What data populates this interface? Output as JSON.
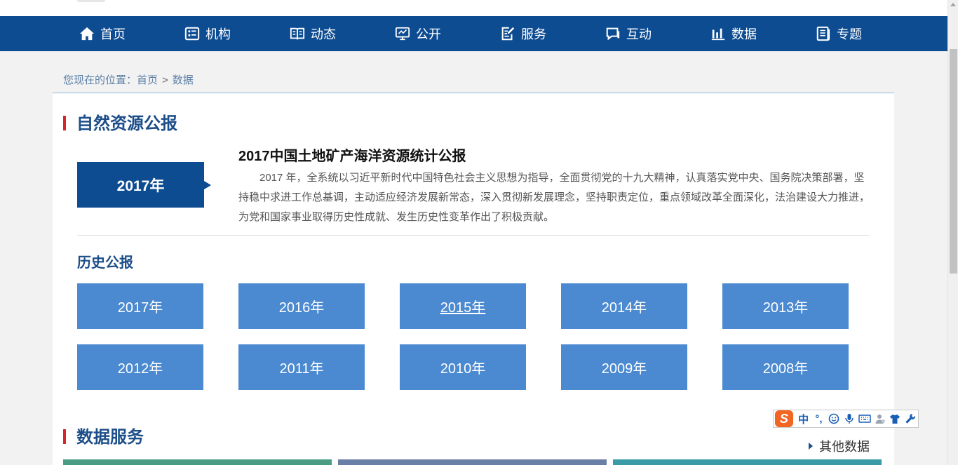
{
  "nav": {
    "items": [
      {
        "label": "首页",
        "icon": "home-icon"
      },
      {
        "label": "机构",
        "icon": "org-icon"
      },
      {
        "label": "动态",
        "icon": "book-icon"
      },
      {
        "label": "公开",
        "icon": "monitor-icon"
      },
      {
        "label": "服务",
        "icon": "edit-icon"
      },
      {
        "label": "互动",
        "icon": "chat-icon"
      },
      {
        "label": "数据",
        "icon": "bar-chart-icon"
      },
      {
        "label": "专题",
        "icon": "news-icon"
      }
    ]
  },
  "breadcrumb": {
    "prefix": "您现在的位置：",
    "home": "首页",
    "sep": ">",
    "current": "数据"
  },
  "section1": {
    "title": "自然资源公报",
    "year_tag": "2017年",
    "report_title": "2017中国土地矿产海洋资源统计公报",
    "report_desc": "2017 年，全系统以习近平新时代中国特色社会主义思想为指导，全面贯彻党的十九大精神，认真落实党中央、国务院决策部署，坚持稳中求进工作总基调，主动适应经济发展新常态，深入贯彻新发展理念，坚持职责定位，重点领域改革全面深化，法治建设大力推进，为党和国家事业取得历史性成就、发生历史性变革作出了积极贡献。"
  },
  "history": {
    "title": "历史公报",
    "years": [
      "2017年",
      "2016年",
      "2015年",
      "2014年",
      "2013年",
      "2012年",
      "2011年",
      "2010年",
      "2009年",
      "2008年"
    ]
  },
  "section2": {
    "title": "数据服务",
    "other_link": "其他数据"
  },
  "ime": {
    "logo": "S",
    "mode": "中",
    "punct": "°,"
  },
  "colors": {
    "nav_bg": "#0e4c92",
    "year_btn": "#4b8ad0",
    "accent_red": "#d7262b",
    "bar1": "#4a9d83",
    "bar2": "#6a7fa6",
    "bar3": "#3a9ba6"
  }
}
